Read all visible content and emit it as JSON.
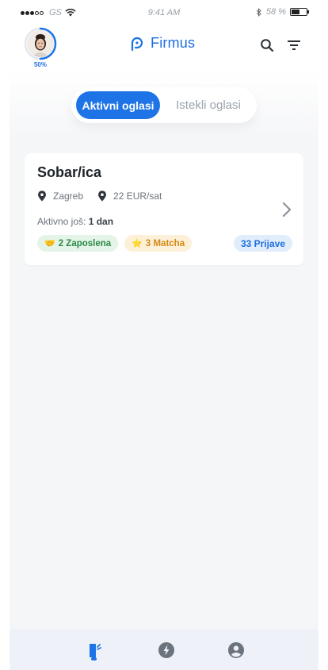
{
  "status_bar": {
    "carrier": "GS",
    "time": "9:41 AM",
    "battery_text": "58 %",
    "battery_level": 0.58
  },
  "header": {
    "avatar_progress_label": "50%",
    "avatar_progress": 0.5,
    "logo_text": "Firmus",
    "icons": [
      "search-icon",
      "filter-icon"
    ]
  },
  "tabs": {
    "active_label": "Aktivni oglasi",
    "inactive_label": "Istekli oglasi"
  },
  "jobs": [
    {
      "title": "Sobar/ica",
      "city": "Zagreb",
      "rate": "22 EUR/sat",
      "active_prefix": "Aktivno još:",
      "active_value": "1 dan",
      "employed_label": "2 Zaposlena",
      "match_label": "3 Matcha",
      "applications_label": "33 Prijave"
    }
  ],
  "bottom_nav": {
    "items": [
      "jobs-icon",
      "flash-icon",
      "profile-icon"
    ],
    "active_index": 0
  },
  "colors": {
    "primary": "#1e74e6",
    "green_chip": "#2b8a44",
    "yellow_chip": "#d58a14",
    "background": "#f5f6f8"
  }
}
